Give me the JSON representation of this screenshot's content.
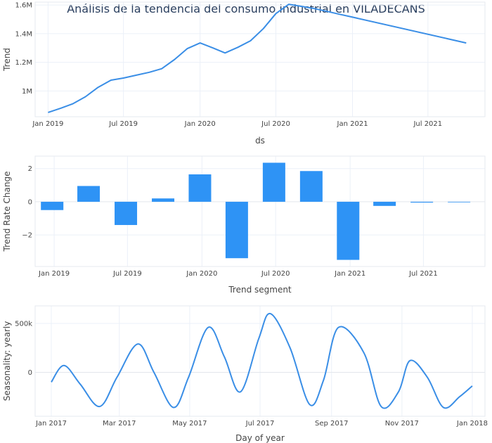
{
  "title": "Análisis de la tendencia del consumo industrial en VILADECANS",
  "colors": {
    "line": "#3a8ee6",
    "bar": "#2e93f5",
    "grid": "#ebf0f8"
  },
  "chart_data": [
    {
      "type": "line",
      "xlabel": "ds",
      "ylabel": "Trend",
      "xticks": [
        "2019-01-01",
        "2019-07-01",
        "2020-01-01",
        "2020-07-01",
        "2021-01-01",
        "2021-07-01"
      ],
      "xtick_labels": [
        "Jan 2019",
        "Jul 2019",
        "Jan 2020",
        "Jul 2020",
        "Jan 2021",
        "Jul 2021"
      ],
      "xlim": [
        "2018-12-01",
        "2021-11-15"
      ],
      "yticks": [
        1000000,
        1200000,
        1400000,
        1600000
      ],
      "ytick_labels": [
        "1M",
        "1.2M",
        "1.4M",
        "1.6M"
      ],
      "ylim": [
        820000,
        1620000
      ],
      "x": [
        "2019-01-01",
        "2019-02-01",
        "2019-03-01",
        "2019-04-01",
        "2019-05-01",
        "2019-06-01",
        "2019-07-01",
        "2019-08-01",
        "2019-09-01",
        "2019-10-01",
        "2019-11-01",
        "2019-12-01",
        "2020-01-01",
        "2020-02-01",
        "2020-03-01",
        "2020-04-01",
        "2020-05-01",
        "2020-06-01",
        "2020-07-01",
        "2020-08-01",
        "2020-09-01",
        "2020-10-01",
        "2020-11-01",
        "2020-12-01",
        "2021-01-01",
        "2021-10-01"
      ],
      "y": [
        850000,
        880000,
        910000,
        960000,
        1025000,
        1075000,
        1090000,
        1110000,
        1130000,
        1155000,
        1220000,
        1295000,
        1335000,
        1300000,
        1265000,
        1305000,
        1350000,
        1435000,
        1540000,
        1605000,
        1590000,
        1575000,
        1555000,
        1535000,
        1515000,
        1335000
      ]
    },
    {
      "type": "bar",
      "xlabel": "Trend segment",
      "ylabel": "Trend Rate Change",
      "xticks": [
        "2019-01-01",
        "2019-07-01",
        "2020-01-01",
        "2020-07-01",
        "2021-01-01",
        "2021-07-01"
      ],
      "xtick_labels": [
        "Jan 2019",
        "Jul 2019",
        "Jan 2020",
        "Jul 2020",
        "Jan 2021",
        "Jul 2021"
      ],
      "xlim": [
        "2018-11-15",
        "2021-11-30"
      ],
      "yticks": [
        -2,
        0,
        2
      ],
      "ytick_labels": [
        "−2",
        "0",
        "2"
      ],
      "ylim": [
        -3.9,
        2.75
      ],
      "x": [
        "2018-12-27",
        "2019-03-27",
        "2019-06-27",
        "2019-09-27",
        "2019-12-27",
        "2020-03-27",
        "2020-06-27",
        "2020-09-27",
        "2020-12-27",
        "2021-03-27",
        "2021-06-27",
        "2021-09-27"
      ],
      "values": [
        -0.5,
        0.95,
        -1.4,
        0.2,
        1.65,
        -3.4,
        2.35,
        1.85,
        -3.5,
        -0.25,
        -0.05,
        -0.02
      ]
    },
    {
      "type": "line",
      "xlabel": "Day of year",
      "ylabel": "Seasonality: yearly",
      "xticks": [
        "2017-01-01",
        "2017-03-01",
        "2017-05-01",
        "2017-07-01",
        "2017-09-01",
        "2017-11-01",
        "2018-01-01"
      ],
      "xtick_labels": [
        "Jan 2017",
        "Mar 2017",
        "May 2017",
        "Jul 2017",
        "Sep 2017",
        "Nov 2017",
        "Jan 2018"
      ],
      "xlim": [
        "2016-12-18",
        "2018-01-12"
      ],
      "yticks": [
        0,
        500000
      ],
      "ytick_labels": [
        "0",
        "500k"
      ],
      "ylim": [
        -450000,
        680000
      ],
      "x": [
        "2017-01-01",
        "2017-01-12",
        "2017-01-26",
        "2017-02-12",
        "2017-02-27",
        "2017-03-17",
        "2017-03-31",
        "2017-04-17",
        "2017-04-30",
        "2017-05-17",
        "2017-05-31",
        "2017-06-14",
        "2017-06-30",
        "2017-07-10",
        "2017-07-27",
        "2017-08-13",
        "2017-08-25",
        "2017-09-07",
        "2017-09-29",
        "2017-10-14",
        "2017-10-29",
        "2017-11-08",
        "2017-11-23",
        "2017-12-07",
        "2017-12-21",
        "2018-01-01"
      ],
      "y": [
        -100000,
        70000,
        -120000,
        -350000,
        -50000,
        290000,
        0,
        -360000,
        -50000,
        460000,
        160000,
        -200000,
        350000,
        600000,
        250000,
        -330000,
        -80000,
        460000,
        200000,
        -350000,
        -200000,
        120000,
        -50000,
        -360000,
        -250000,
        -140000
      ]
    }
  ]
}
